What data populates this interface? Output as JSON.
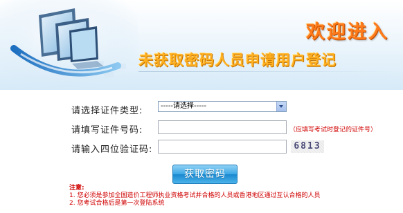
{
  "banner": {
    "welcome": "欢迎进入",
    "subtitle": "未获取密码人员申请用户登记"
  },
  "form": {
    "cert_type": {
      "label": "请选择证件类型:",
      "selected": "-----请选择-----"
    },
    "cert_number": {
      "label": "请填写证件号码:",
      "value": "",
      "hint": "（应填写考试时登记的证件号）"
    },
    "captcha": {
      "label": "请输入四位验证码:",
      "value": "",
      "code": "6813"
    },
    "submit_label": "获取密码"
  },
  "notes": {
    "title": "注意:",
    "items": [
      "1. 您必须是参加全国造价工程师执业资格考试并合格的人员或香港地区通过互认合格的人员",
      "2. 您考试合格后是第一次登陆系统"
    ]
  },
  "colors": {
    "accent_orange": "#ff7a1a",
    "subtitle_yellow": "#ffb020",
    "note_red": "#d00000",
    "button_blue": "#3ba6e4"
  }
}
